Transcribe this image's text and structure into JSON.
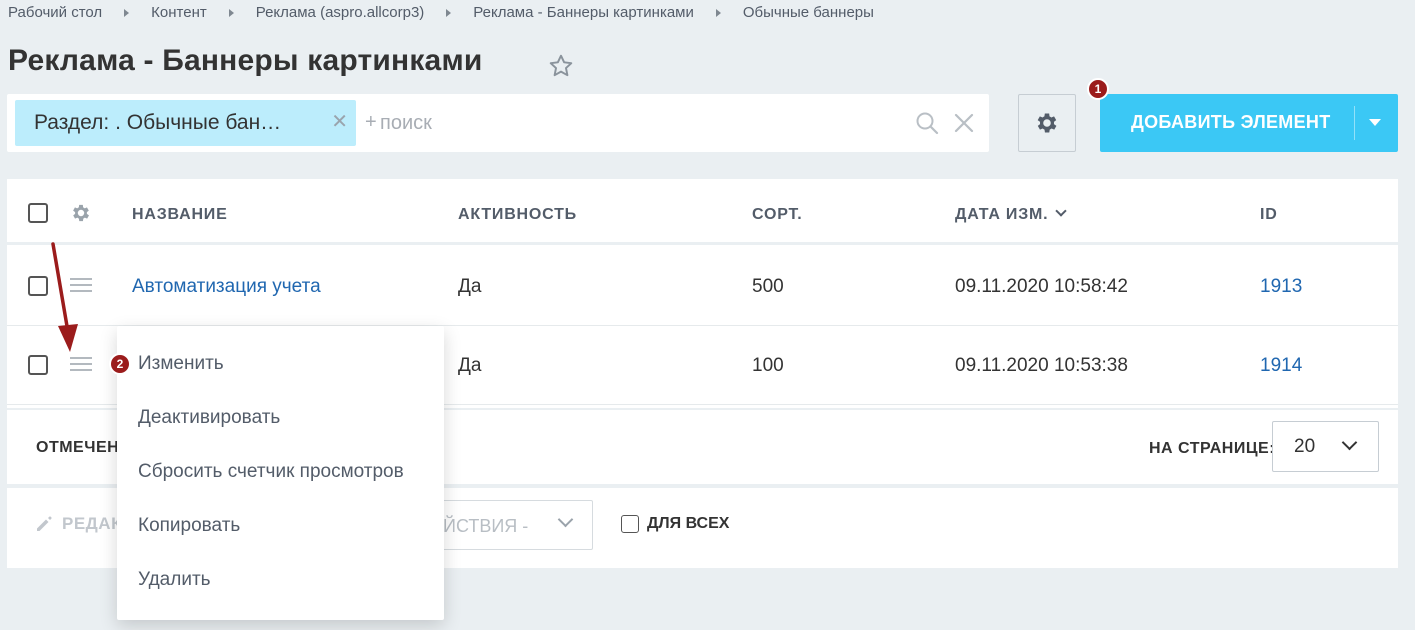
{
  "breadcrumbs": [
    "Рабочий стол",
    "Контент",
    "Реклама (aspro.allcorp3)",
    "Реклама - Баннеры картинками",
    "Обычные баннеры"
  ],
  "page_title": "Реклама - Баннеры картинками",
  "filter": {
    "chip_label": "Раздел: . Обычные бан…",
    "search_placeholder": "поиск"
  },
  "toolbar": {
    "add_label": "ДОБАВИТЬ ЭЛЕМЕНТ"
  },
  "annotations": {
    "badge_1": "1",
    "badge_2": "2"
  },
  "table": {
    "headers": {
      "name": "НАЗВАНИЕ",
      "active": "АКТИВНОСТЬ",
      "sort": "СОРТ.",
      "date": "ДАТА ИЗМ.",
      "id": "ID"
    },
    "rows": [
      {
        "name": "Автоматизация учета",
        "active": "Да",
        "sort": "500",
        "date": "09.11.2020 10:58:42",
        "id": "1913"
      },
      {
        "name": "",
        "active": "Да",
        "sort": "100",
        "date": "09.11.2020 10:53:38",
        "id": "1914"
      }
    ]
  },
  "footer": {
    "selected_label": "ОТМЕЧЕН",
    "per_page_label": "НА СТРАНИЦЕ:",
    "per_page_value": "20",
    "edit_label": "РЕДАК",
    "actions_label": "ЕЙСТВИЯ -",
    "for_all_label": "ДЛЯ ВСЕХ"
  },
  "context_menu": {
    "items": [
      "Изменить",
      "Деактивировать",
      "Сбросить счетчик просмотров",
      "Копировать",
      "Удалить"
    ]
  },
  "colors": {
    "accent": "#3bc8f5",
    "chip": "#bcedfc",
    "badge": "#9b1c1c",
    "link": "#2067b0",
    "background": "#eaeff2"
  }
}
